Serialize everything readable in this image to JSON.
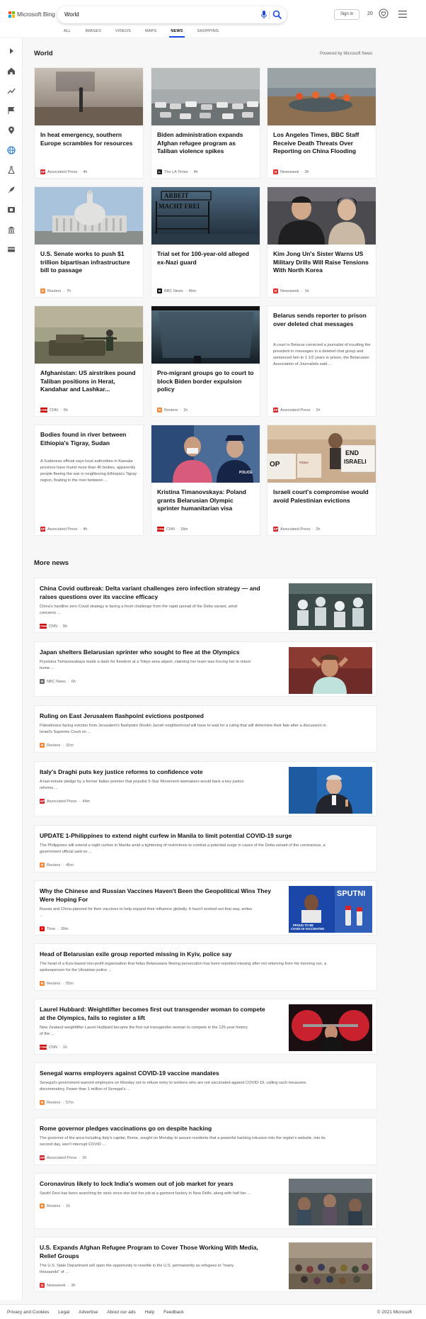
{
  "header": {
    "brand": "Microsoft Bing",
    "query": "World",
    "sign_in": "Sign in",
    "points": "20",
    "logo_colors": [
      "#f25022",
      "#7fba00",
      "#00a4ef",
      "#ffb900"
    ]
  },
  "tabs": [
    "ALL",
    "IMAGES",
    "VIDEOS",
    "MAPS",
    "NEWS",
    "SHOPPING"
  ],
  "active_tab": "NEWS",
  "section": {
    "title": "World",
    "powered_by": "Powered by Microsoft News"
  },
  "rail_icons": [
    "expand-icon",
    "home-icon",
    "trending-icon",
    "flag-icon",
    "location-pin-icon",
    "globe-icon",
    "science-icon",
    "rocket-icon",
    "movie-icon",
    "bank-icon",
    "card-icon"
  ],
  "cards": [
    {
      "title": "In heat emergency, southern Europe scrambles for resources",
      "source": "Associated Press",
      "time": "4h",
      "badge": "AP",
      "badge_color": "#d4252b"
    },
    {
      "title": "Biden administration expands Afghan refugee program as Taliban violence spikes",
      "source": "The LA Times",
      "time": "4h",
      "badge": "L",
      "badge_color": "#222222"
    },
    {
      "title": "Los Angeles Times, BBC Staff Receive Death Threats Over Reporting on China Flooding",
      "source": "Newsweek",
      "time": "3h",
      "badge": "N",
      "badge_color": "#e8312d"
    },
    {
      "title": "U.S. Senate works to push $1 trillion bipartisan infrastructure bill to passage",
      "source": "Reuters",
      "time": "7h",
      "badge": "R",
      "badge_color": "#f58a3c"
    },
    {
      "title": "Trial set for 100-year-old alleged ex-Nazi guard",
      "source": "BBC News",
      "time": "46m",
      "badge": "B",
      "badge_color": "#111111"
    },
    {
      "title": "Kim Jong Un's Sister Warns US Military Drills Will Raise Tensions With North Korea",
      "source": "Newsweek",
      "time": "1h",
      "badge": "N",
      "badge_color": "#e8312d"
    },
    {
      "title": "Afghanistan: US airstrikes pound Taliban positions in Herat, Kandahar and Lashkar...",
      "source": "CNN",
      "time": "5h",
      "badge": "CNN",
      "badge_color": "#cc0000"
    },
    {
      "title": "Pro-migrant groups go to court to block Biden border expulsion policy",
      "source": "Reuters",
      "time": "1h",
      "badge": "R",
      "badge_color": "#f58a3c"
    },
    {
      "title": "Belarus sends reporter to prison over deleted chat messages",
      "snippet": "A court in Belarus convicted a journalist of insulting the president in messages in a deleted chat group and sentenced him to 1 1/2 years in prison, the Belarusian Association of Journalists said ...",
      "source": "Associated Press",
      "time": "1h",
      "badge": "AP",
      "badge_color": "#d4252b"
    },
    {
      "title": "Bodies found in river between Ethiopia's Tigray, Sudan",
      "snippet": "A Sudanese official says local authorities in Kassala province have found more than 40 bodies, apparently people fleeing the war in neighboring Ethiopia's Tigray region, floating in the river between ...",
      "source": "Associated Press",
      "time": "4h",
      "badge": "AP",
      "badge_color": "#d4252b"
    },
    {
      "title": "Kristina Timanovskaya: Poland grants Belarusian Olympic sprinter humanitarian visa",
      "source": "CNN",
      "time": "18m",
      "badge": "CNN",
      "badge_color": "#cc0000"
    },
    {
      "title": "Israeli court's compromise would avoid Palestinian evictions",
      "source": "Associated Press",
      "time": "2h",
      "badge": "AP",
      "badge_color": "#d4252b"
    }
  ],
  "more_news_title": "More news",
  "more_news": [
    {
      "title_lines": [
        "China Covid outbreak: Delta variant challenges zero infection strategy — and",
        "raises questions over its vaccine efficacy"
      ],
      "snippet_lines": [
        "China's hardline zero Covid strategy is facing a fresh challenge from the rapid spread of the Delta variant, amid",
        "concerns ..."
      ],
      "source": "CNN",
      "time": "9h",
      "badge": "CNN",
      "badge_color": "#cc0000"
    },
    {
      "title_lines": [
        "Japan shelters Belarusian sprinter who sought to flee at the Olympics"
      ],
      "snippet_lines": [
        "Krystsina Tsimanouskaya made a dash for freedom at a Tokyo-area airport, claiming her team was forcing her to return",
        "home ..."
      ],
      "source": "NBC News",
      "time": "6h",
      "badge": "N",
      "badge_color": "#6d6d6d"
    },
    {
      "title_lines": [
        "Ruling on East Jerusalem flashpoint evictions postponed"
      ],
      "snippet_lines": [
        "Palestinians facing eviction from Jerusalem's flashpoint Sheikh Jarrah neighborhood will have to wait for a ruling that will determine their fate after a discussion in",
        "Israel's Supreme Court on ..."
      ],
      "source": "Reuters",
      "time": "31m",
      "badge": "R",
      "badge_color": "#f58a3c"
    },
    {
      "title_lines": [
        "Italy's Draghi puts key justice reforms to confidence vote"
      ],
      "snippet_lines": [
        "A last-minute pledge by a former Italian premier that populist 5-Star Movement lawmakers would back a key justice",
        "reforms ..."
      ],
      "source": "Associated Press",
      "time": "44m",
      "badge": "AP",
      "badge_color": "#d4252b"
    },
    {
      "title_lines": [
        "UPDATE 1-Philippines to extend night curfew in Manila to limit potential COVID-19 surge"
      ],
      "snippet_lines": [
        "The Philippines will extend a night curfew in Manila amid a tightening of restrictions to combat a potential surge in cases of the Delta variant of the coronavirus, a",
        "government official said on ..."
      ],
      "source": "Reuters",
      "time": "45m",
      "badge": "R",
      "badge_color": "#f58a3c"
    },
    {
      "title_lines": [
        "Why the Chinese and Russian Vaccines Haven't Been the Geopolitical Wins They",
        "Were Hoping For"
      ],
      "snippet_lines": [
        "Russia and China planned for their vaccines to help expand their influence globally. It hasn't worked out that way, writes",
        "..."
      ],
      "source": "Time",
      "time": "30m",
      "badge": "T",
      "badge_color": "#e90606",
      "thumb_text": "SPUTNI",
      "thumb_caption": "PROUD TO BE COVID-19 VACCINATED"
    },
    {
      "title_lines": [
        "Head of Belarusian exile group reported missing in Kyiv, police say"
      ],
      "snippet_lines": [
        "The head of a Kyiv-based non-profit organisation that helps Belarusians fleeing persecution has been reported missing after not returning from his morning run, a",
        "spokesperson for the Ukrainian police ..."
      ],
      "source": "Reuters",
      "time": "55m",
      "badge": "R",
      "badge_color": "#f58a3c"
    },
    {
      "title_lines": [
        "Laurel Hubbard: Weightlifter becomes first out transgender woman to compete",
        "at the Olympics, fails to register a lift"
      ],
      "snippet_lines": [
        "New Zealand weightlifter Laurel Hubbard became the first out transgender woman to compete in the 125-year history",
        "of the ..."
      ],
      "source": "CNN",
      "time": "1h",
      "badge": "CNN",
      "badge_color": "#cc0000"
    },
    {
      "title_lines": [
        "Senegal warns employers against COVID-19 vaccine mandates"
      ],
      "snippet_lines": [
        "Senegal's government warned employers on Monday not to refuse entry to workers who are not vaccinated against COVID-19, calling such measures",
        "discriminatory. Fewer than 1 million of Senegal's ..."
      ],
      "source": "Reuters",
      "time": "57m",
      "badge": "R",
      "badge_color": "#f58a3c"
    },
    {
      "title_lines": [
        "Rome governor pledges vaccinations go on despite hacking"
      ],
      "snippet_lines": [
        "The governor of the area including Italy's capital, Rome, sought on Monday to assure residents that a powerful hacking intrusion into the region's website, into its",
        "second day, won't interrupt COVID ..."
      ],
      "source": "Associated Press",
      "time": "2h",
      "badge": "AP",
      "badge_color": "#d4252b"
    },
    {
      "title_lines": [
        "Coronavirus likely to lock India's women out of job market for years"
      ],
      "snippet_lines": [
        "Savitri Devi has been searching for work since she lost her job at a garment factory in New Delhi, along with half her ..."
      ],
      "source": "Reuters",
      "time": "1h",
      "badge": "R",
      "badge_color": "#f58a3c"
    },
    {
      "title_lines": [
        "U.S. Expands Afghan Refugee Program to Cover Those Working With Media,",
        "Relief Groups"
      ],
      "snippet_lines": [
        "The U.S. State Department will open the opportunity to resettle in the U.S. permanently as refugees to \"many",
        "thousands\" of ..."
      ],
      "source": "Newsweek",
      "time": "3h",
      "badge": "N",
      "badge_color": "#e8312d"
    }
  ],
  "card_images": {
    "c1": [
      "#b4aba0",
      "#7d7066"
    ],
    "c2": [
      "#9aa0a3",
      "#5d6466"
    ],
    "c3": [
      "#6d7b83",
      "#8a6d52"
    ],
    "c4": [
      "#a9c3dc",
      "#cfd2d3"
    ],
    "c5": [
      "#3b556a",
      "#1b2631"
    ],
    "c6": [
      "#3d3c41",
      "#b6a48f"
    ],
    "c7": [
      "#8a8c71",
      "#514d3a"
    ],
    "c8": [
      "#3e5261",
      "#141f26"
    ],
    "c10": [
      "#1f3d6e",
      "#c7ccd4"
    ],
    "c11": [
      "#c9ad8e",
      "#d8cdbf"
    ]
  },
  "footer": {
    "links": [
      "Privacy and Cookies",
      "Legal",
      "Advertise",
      "About our ads",
      "Help",
      "Feedback"
    ],
    "copyright": "© 2021 Microsoft"
  }
}
